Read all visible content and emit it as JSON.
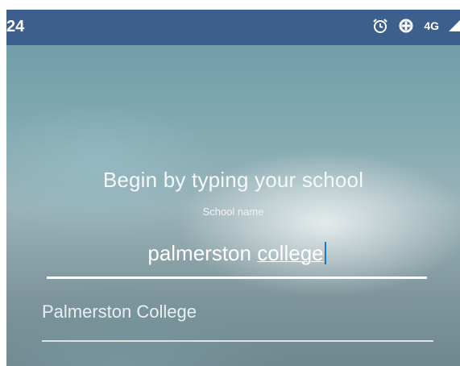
{
  "status_bar": {
    "time": "24",
    "network": "4G",
    "icons": [
      "alarm-icon",
      "data-saver-icon",
      "signal-icon"
    ]
  },
  "colors": {
    "status_bar_bg": "#3d5f8e",
    "text": "#ffffff",
    "caret": "#1d77c6"
  },
  "heading": "Begin by typing your school",
  "school_field": {
    "label": "School name",
    "value_word_1": "palmerston",
    "value_word_2": "college"
  },
  "suggestions": [
    {
      "label": "Palmerston College"
    }
  ]
}
